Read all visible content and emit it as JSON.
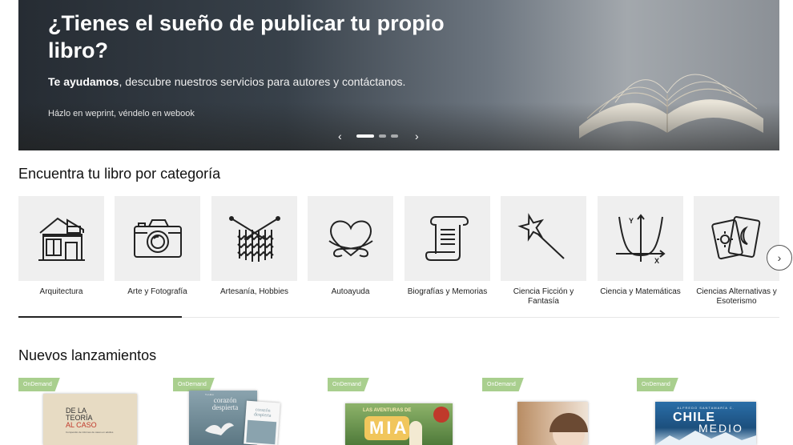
{
  "hero": {
    "title": "¿Tienes el sueño de publicar tu propio libro?",
    "subtitle_bold": "Te ayudamos",
    "subtitle_rest": ", descubre nuestros servicios para autores y contáctanos.",
    "small": "Házlo en weprint, véndelo en webook",
    "prev_icon": "‹",
    "next_icon": "›",
    "slides": 3,
    "active_slide": 1
  },
  "categories": {
    "title": "Encuentra tu libro por categoría",
    "items": [
      {
        "label": "Arquitectura",
        "icon": "building-icon"
      },
      {
        "label": "Arte y Fotografía",
        "icon": "camera-icon"
      },
      {
        "label": "Artesanía, Hobbies",
        "icon": "knitting-icon"
      },
      {
        "label": "Autoayuda",
        "icon": "self-hug-heart-icon"
      },
      {
        "label": "Biografías y Memorias",
        "icon": "scroll-icon"
      },
      {
        "label": "Ciencia Ficción y Fantasía",
        "icon": "magic-wand-icon"
      },
      {
        "label": "Ciencia y Matemáticas",
        "icon": "parabola-graph-icon"
      },
      {
        "label": "Ciencias Alternativas y Esoterismo",
        "icon": "tarot-cards-icon"
      }
    ],
    "next_icon": "›"
  },
  "releases": {
    "title": "Nuevos lanzamientos",
    "books": [
      {
        "badge": "OnDemand",
        "cover_lines": [
          "DE LA",
          "TEORÍA",
          "AL CASO"
        ],
        "cover_small": "Compendio de informes de casos en adultos",
        "cover_color": "#e7dbc3"
      },
      {
        "badge": "OnDemand",
        "cover_small_top": "Tu Libro",
        "cover_title": "corazón despierta",
        "cover_color": "#6f8c99"
      },
      {
        "badge": "OnDemand",
        "cover_top": "LAS AVENTURAS DE",
        "cover_title": "MIA",
        "cover_color": "#5b7b43"
      },
      {
        "badge": "OnDemand",
        "cover_color": "#c7a98a"
      },
      {
        "badge": "OnDemand",
        "cover_author": "ALFREDO SANTAMARÍA C.",
        "cover_title": "CHILE",
        "cover_sub": "MEDIO",
        "cover_color": "#1e5b8c"
      }
    ]
  }
}
